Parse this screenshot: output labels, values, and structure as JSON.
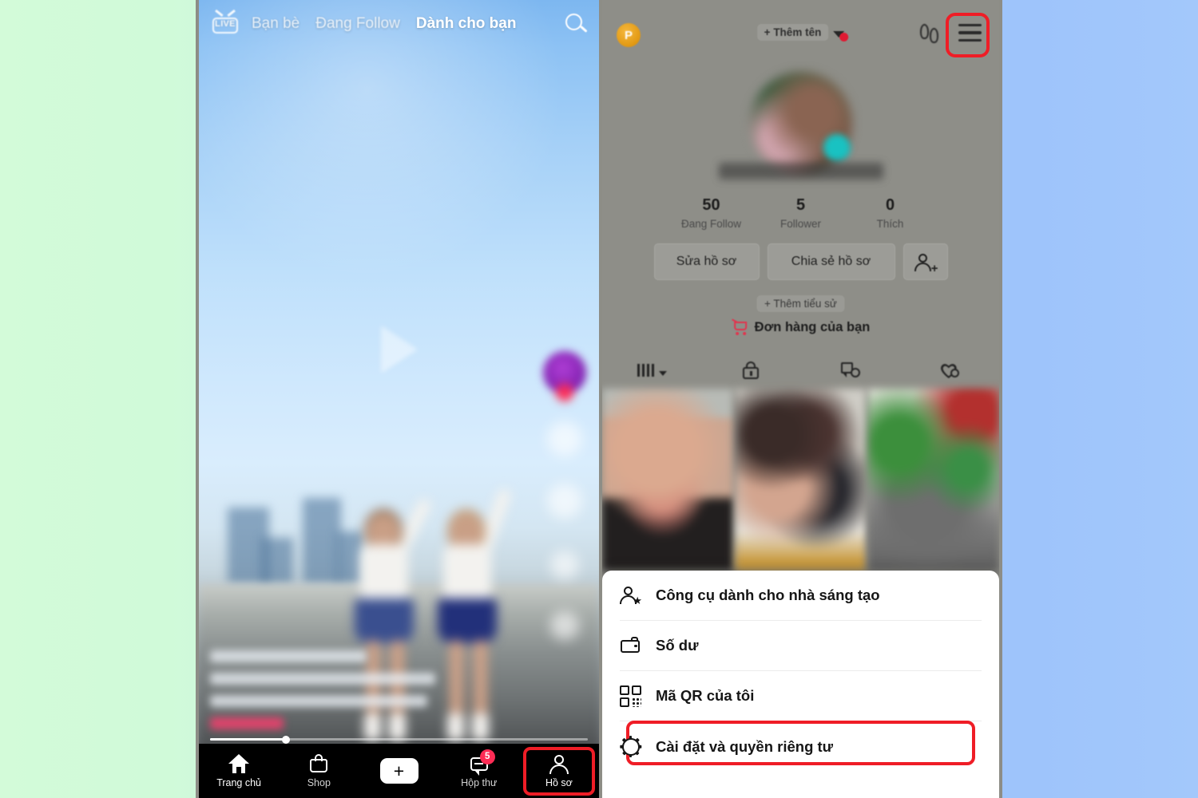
{
  "background": {
    "left_color": "#d3fbd9",
    "right_color": "#9cc2fa"
  },
  "highlight_color": "#ef1d26",
  "left_phone": {
    "top_nav": {
      "live_label": "LIVE",
      "tabs": [
        {
          "label": "Bạn bè",
          "active": false
        },
        {
          "label": "Đang Follow",
          "active": false
        },
        {
          "label": "Dành cho bạn",
          "active": true
        }
      ],
      "search_icon": "search-icon"
    },
    "video": {
      "play_icon": "play-icon",
      "progress_percent": 20,
      "rail_icons": [
        "creator-avatar",
        "like-heart-icon",
        "comment-icon",
        "bookmark-icon",
        "share-icon"
      ]
    },
    "tabbar": [
      {
        "label": "Trang chủ",
        "icon": "home-icon",
        "badge": "",
        "highlighted": false
      },
      {
        "label": "Shop",
        "icon": "shop-bag-icon",
        "badge": "",
        "highlighted": false
      },
      {
        "label": "",
        "icon": "create-plus-icon",
        "badge": "",
        "highlighted": false
      },
      {
        "label": "Hộp thư",
        "icon": "inbox-message-icon",
        "badge": "5",
        "highlighted": false
      },
      {
        "label": "Hồ sơ",
        "icon": "profile-person-icon",
        "badge": "",
        "highlighted": true
      }
    ],
    "create_glyph": "+"
  },
  "right_phone": {
    "header": {
      "pro_badge": "P",
      "add_name_label": "+ Thêm tên",
      "chevron_icon": "chevron-down-icon",
      "notification_dot": true,
      "footprint_icon": "footprint-icon",
      "menu_icon": "hamburger-menu-icon",
      "menu_highlighted": true
    },
    "profile": {
      "avatar_icon": "profile-avatar",
      "avatar_badge_icon": "status-badge",
      "username": "",
      "stats": [
        {
          "value": "50",
          "label": "Đang Follow"
        },
        {
          "value": "5",
          "label": "Follower"
        },
        {
          "value": "0",
          "label": "Thích"
        }
      ],
      "actions": [
        {
          "label": "Sửa hồ sơ",
          "icon": ""
        },
        {
          "label": "Chia sẻ hồ sơ",
          "icon": ""
        },
        {
          "label": "",
          "icon": "add-friend-icon"
        }
      ],
      "bio_label": "+ Thêm tiểu sử",
      "orders_label": "Đơn hàng của bạn",
      "orders_icon": "shopping-cart-icon",
      "tabs": [
        {
          "icon": "video-grid-sort-icon",
          "active": true
        },
        {
          "icon": "private-lock-icon",
          "active": false
        },
        {
          "icon": "repost-icon",
          "active": false
        },
        {
          "icon": "liked-heart-lock-icon",
          "active": false
        }
      ],
      "grid_thumbnails": [
        "video-thumb-1",
        "video-thumb-2",
        "video-thumb-3"
      ]
    },
    "menu_sheet": {
      "items": [
        {
          "label": "Công cụ dành cho nhà sáng tạo",
          "icon": "creator-tools-icon",
          "highlighted": false
        },
        {
          "label": "Số dư",
          "icon": "wallet-icon",
          "highlighted": false
        },
        {
          "label": "Mã QR của tôi",
          "icon": "qr-code-icon",
          "highlighted": false
        },
        {
          "label": "Cài đặt và quyền riêng tư",
          "icon": "gear-icon",
          "highlighted": true
        }
      ]
    }
  }
}
